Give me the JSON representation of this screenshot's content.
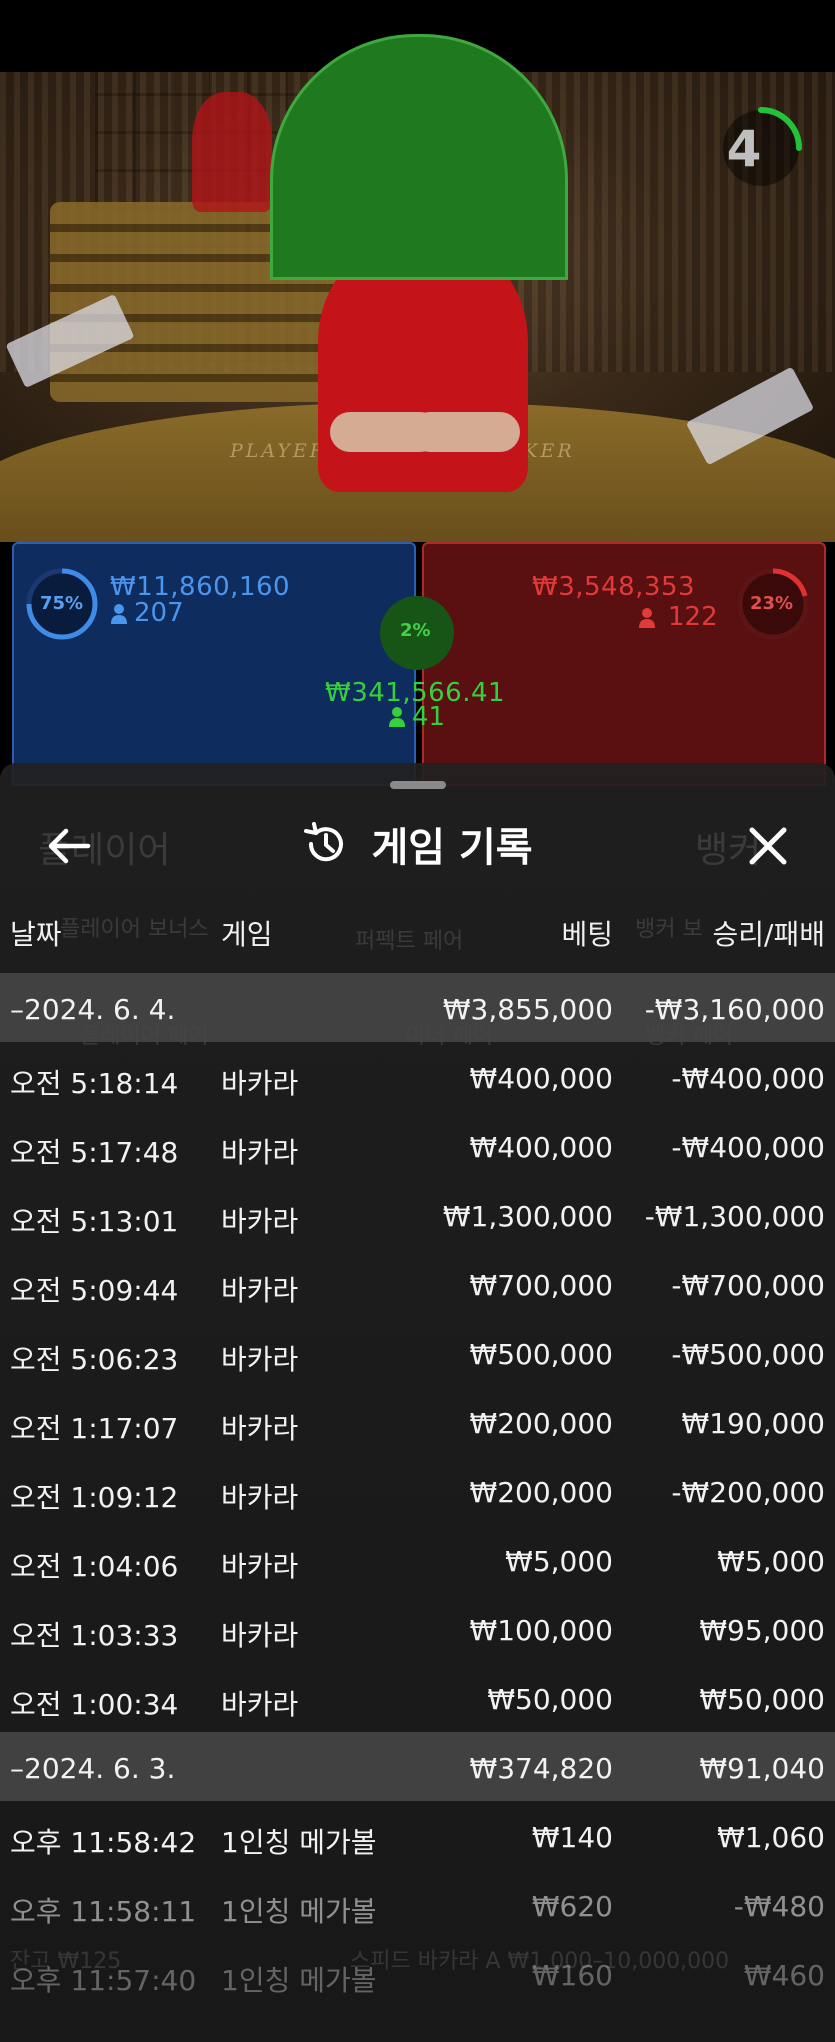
{
  "video": {
    "timer": "4",
    "table_label_player": "PLAYER",
    "table_label_banker": "BANKER"
  },
  "bets": {
    "player": {
      "percent": "75%",
      "amount": "₩11,860,160",
      "count": "207",
      "color": "#3f8ce8"
    },
    "tie": {
      "percent": "2%",
      "amount": "₩341,566.41",
      "count": "41",
      "color": "#21c22a"
    },
    "banker": {
      "percent": "23%",
      "amount": "₩3,548,353",
      "count": "122",
      "color": "#e03232"
    }
  },
  "history": {
    "title": "게임 기록",
    "columns": {
      "date": "날짜",
      "game": "게임",
      "bet": "베팅",
      "result": "승리/패배"
    },
    "groups": [
      {
        "date": "–2024. 6. 4.",
        "bet_total": "₩3,855,000",
        "result_total": "-₩3,160,000",
        "rows": [
          {
            "time": "오전 5:18:14",
            "game": "바카라",
            "bet": "₩400,000",
            "result": "-₩400,000"
          },
          {
            "time": "오전 5:17:48",
            "game": "바카라",
            "bet": "₩400,000",
            "result": "-₩400,000"
          },
          {
            "time": "오전 5:13:01",
            "game": "바카라",
            "bet": "₩1,300,000",
            "result": "-₩1,300,000"
          },
          {
            "time": "오전 5:09:44",
            "game": "바카라",
            "bet": "₩700,000",
            "result": "-₩700,000"
          },
          {
            "time": "오전 5:06:23",
            "game": "바카라",
            "bet": "₩500,000",
            "result": "-₩500,000"
          },
          {
            "time": "오전 1:17:07",
            "game": "바카라",
            "bet": "₩200,000",
            "result": "₩190,000"
          },
          {
            "time": "오전 1:09:12",
            "game": "바카라",
            "bet": "₩200,000",
            "result": "-₩200,000"
          },
          {
            "time": "오전 1:04:06",
            "game": "바카라",
            "bet": "₩5,000",
            "result": "₩5,000"
          },
          {
            "time": "오전 1:03:33",
            "game": "바카라",
            "bet": "₩100,000",
            "result": "₩95,000"
          },
          {
            "time": "오전 1:00:34",
            "game": "바카라",
            "bet": "₩50,000",
            "result": "₩50,000"
          }
        ]
      },
      {
        "date": "–2024. 6. 3.",
        "bet_total": "₩374,820",
        "result_total": "₩91,040",
        "rows": [
          {
            "time": "오후 11:58:42",
            "game": "1인칭 메가볼",
            "bet": "₩140",
            "result": "₩1,060"
          },
          {
            "time": "오후 11:58:11",
            "game": "1인칭 메가볼",
            "bet": "₩620",
            "result": "-₩480"
          },
          {
            "time": "오후 11:57:40",
            "game": "1인칭 메가볼",
            "bet": "₩160",
            "result": "₩460"
          }
        ]
      }
    ]
  },
  "background_ui": {
    "player_label": "플레이어",
    "banker_label": "뱅커",
    "player_bonus": "플레이어 보너스",
    "perfect_pair": "퍼펙트 페어",
    "banker_bonus": "뱅커 보",
    "player_pair": "플레이어 페어",
    "either_pair": "이더 페어",
    "banker_pair": "뱅커 페어",
    "balance": "잔고 ₩125",
    "table_limits": "스피드 바카라 A ₩1,000–10,000,000"
  }
}
